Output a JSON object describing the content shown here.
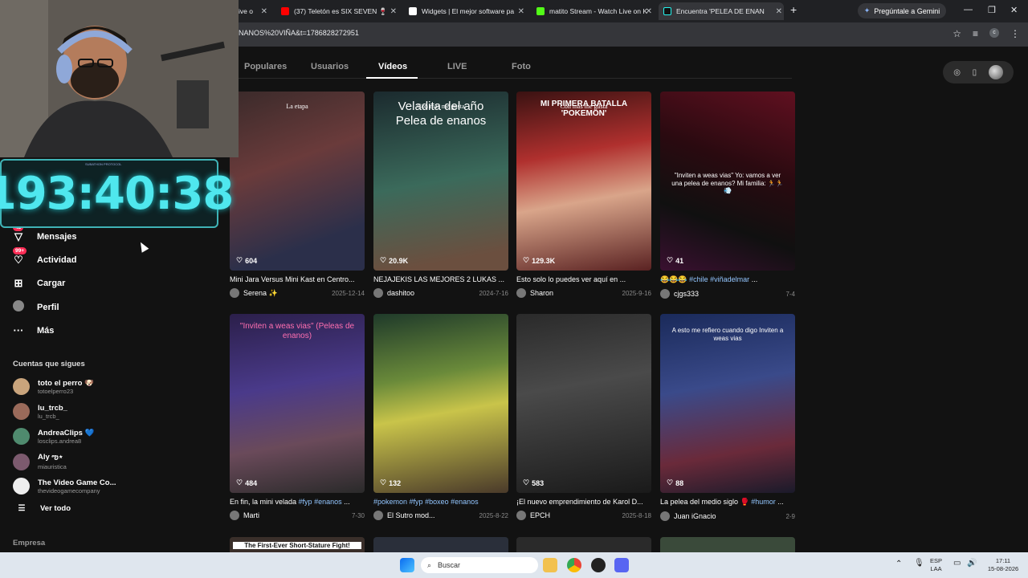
{
  "browser": {
    "tabs": [
      {
        "label": "ive o",
        "color": "#6441a5"
      },
      {
        "label": "(37) Teletón es SIX SEVEN 🍷",
        "color": "#ff0000"
      },
      {
        "label": "Widgets | El mejor software pa",
        "color": "#ffffff"
      },
      {
        "label": "matito Stream - Watch Live on K",
        "color": "#53fc18"
      },
      {
        "label": "Encuentra 'PELEA DE ENAN",
        "color": "#ffffff"
      }
    ],
    "gemini_label": "Pregúntale a Gemini",
    "url": "NANOS%20VIÑA&t=1786828272951"
  },
  "search_tabs": [
    "Populares",
    "Usuarios",
    "Vídeos",
    "LIVE",
    "Foto"
  ],
  "selected_tab": "Vídeos",
  "timer": "193:40:38",
  "timer_caption": "SUBATHON PROTOCOL",
  "nav": [
    {
      "label": "Mensajes",
      "icon": "messages-icon",
      "badge": "42"
    },
    {
      "label": "Actividad",
      "icon": "activity-icon",
      "badge": "99+"
    },
    {
      "label": "Cargar",
      "icon": "upload-icon",
      "badge": ""
    },
    {
      "label": "Perfil",
      "icon": "profile-icon",
      "badge": ""
    },
    {
      "label": "Más",
      "icon": "more-icon",
      "badge": ""
    }
  ],
  "following_title": "Cuentas que sigues",
  "following": [
    {
      "name": "toto el perro 🐶",
      "handle": "totoelperro23",
      "color": "#c9a47c"
    },
    {
      "name": "lu_trcb_",
      "handle": "lu_trcb_",
      "color": "#9a6a5a"
    },
    {
      "name": "AndreaClips 💙",
      "handle": "losclips.andrea8",
      "color": "#4f8a6e"
    },
    {
      "name": "Aly ఌ︎⋆",
      "handle": "miauristica",
      "color": "#7c5a6e"
    },
    {
      "name": "The Video Game Co...",
      "handle": "thevideogamecompany",
      "color": "#eeeeee"
    }
  ],
  "see_all": "Ver todo",
  "empresa": "Empresa",
  "videos": [
    {
      "likes": "604",
      "desc": "Mini Jara Versus Mini Kast en Centro...",
      "user": "Serena ✨",
      "date": "2025-12-14",
      "overlay": "La etapa",
      "bg": "linear-gradient(160deg,#3a2a2a,#6a3b3b 40%,#2b2f4a 80%)"
    },
    {
      "likes": "20.9K",
      "desc": "NEJAJEKIS LAS MEJORES 2 LUKAS ...",
      "user": "dashitoo",
      "date": "2024-7-16",
      "overlay": "Con más me gusta",
      "big": "Veladita del año Pelea de enanos",
      "bg": "linear-gradient(170deg,#1b2a2e,#3b6a5b 50%,#6b4f3f 90%)"
    },
    {
      "likes": "129.3K",
      "desc": "Esto solo lo puedes ver aquí en ...",
      "user": "Sharon",
      "date": "2025-9-16",
      "overlay": "Con más me gusta",
      "big": "MI PRIMERA BATALLA 'POKEMON'",
      "bg": "linear-gradient(170deg,#3a1212,#b0302e 35%,#d9a58a 60%,#5a2222)"
    },
    {
      "likes": "41",
      "desc": "😂😂😂 #chile #viñadelmar ...",
      "user": "cjgs333",
      "date": "7-4",
      "overlay": "",
      "big": "\"Inviten a weas vias\" Yo: vamos a ver una pelea de enanos? Mi familia: 🏃🏃💨",
      "bg": "linear-gradient(200deg,#601020,#2a0a10 40%,#101010 70%,#3a1030)"
    },
    {
      "likes": "484",
      "desc": "En fin, la mini velada #fyp #enanos ...",
      "user": "Marti",
      "date": "7-30",
      "overlay": "",
      "big": "\"Inviten a weas vias\" (Peleas de enanos)",
      "bg": "linear-gradient(170deg,#2b1f4a,#4a3a8a 40%,#6a4a5a 70%,#2a2a2a)"
    },
    {
      "likes": "132",
      "desc": "#pokemon #fyp #boxeo #enanos",
      "user": "El Sutro mod...",
      "date": "2025-8-22",
      "overlay": "",
      "big": "",
      "bg": "linear-gradient(170deg,#1f3a2a,#6a8a3a 35%,#c9c44a 55%,#4a3a2a)"
    },
    {
      "likes": "583",
      "desc": "¡El nuevo emprendimiento de Karol D...",
      "user": "EPCH",
      "date": "2025-8-18",
      "overlay": "",
      "big": "",
      "bg": "linear-gradient(170deg,#2a2a2a,#4a4a4a 40%,#1a1a1a)"
    },
    {
      "likes": "88",
      "desc": "La pelea del medio siglo 🥊 #humor ...",
      "user": "Juan iGnacio",
      "date": "2-9",
      "overlay": "",
      "big": "A esto me refiero cuando digo Inviten a weas vias",
      "bg": "linear-gradient(170deg,#1a2a5a,#3a4a8a 40%,#6a2a3a 75%,#1a1a2a)"
    }
  ],
  "bottom_row": [
    {
      "overlay": "The First-Ever Short-Stature Fight!",
      "bg": "#3a2f2a"
    },
    {
      "overlay": "",
      "bg": "#2a2f3a"
    },
    {
      "overlay": "",
      "bg": "#2a2a2a"
    },
    {
      "overlay": "",
      "bg": "#3a4a3a"
    }
  ],
  "taskbar": {
    "search": "Buscar",
    "lang1": "ESP",
    "lang2": "LAA",
    "time": "17:11",
    "date": "15-08-2026"
  }
}
